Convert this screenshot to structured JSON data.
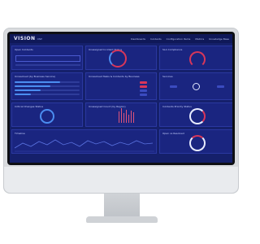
{
  "app": {
    "logo": "VISION",
    "logo_sub": "ONE"
  },
  "nav": [
    "Dashboards",
    "Incidents",
    "Configuration Items",
    "Metrics",
    "Knowledge Base"
  ],
  "panels": {
    "p1": "Open Incidents",
    "p2": "Unassigned Incident Status",
    "p3": "SLA Compliance",
    "p4": "Unresolved (by Business Service)",
    "p5": "Unresolved Tasks & Incidents by Business",
    "p6": "Services",
    "p7": "Critical Changes Status",
    "p8": "Unassigned Count (by Region)",
    "p9": "Incidents Priority Status",
    "p10": "Timeline",
    "p11": "Open vs Resolved"
  },
  "colors": {
    "screen_bg": "#15206b",
    "panel_bg": "#1a2580",
    "accent_red": "#e0557a",
    "accent_blue": "#4b8df0"
  }
}
